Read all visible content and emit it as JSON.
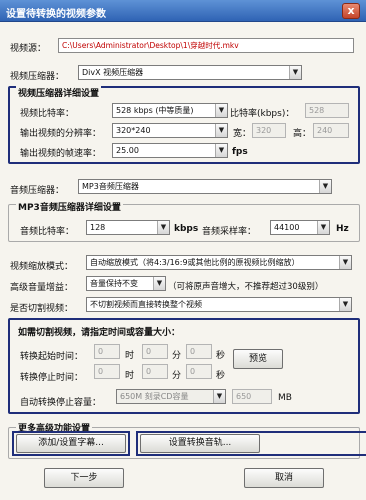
{
  "window": {
    "title": "设置待转换的视频参数",
    "close_label": "x"
  },
  "source": {
    "label": "视频源：",
    "path": "C:\\Users\\Administrator\\Desktop\\1\\穿越时代.mkv"
  },
  "video_codec": {
    "label": "视频压缩器：",
    "value": "DivX 视频压缩器"
  },
  "video_details": {
    "title": "视频压缩器详细设置",
    "bitrate_label": "视频比特率：",
    "bitrate_value": "528  kbps (中等质量)",
    "bitrate_kbps_label": "比特率(kbps)：",
    "bitrate_kbps_value": "528",
    "resolution_label": "输出视频的分辨率：",
    "resolution_value": "320*240",
    "width_label": "宽：",
    "width_value": "320",
    "height_label": "高：",
    "height_value": "240",
    "fps_label": "输出视频的帧速率：",
    "fps_value": "25.00",
    "fps_unit": "fps"
  },
  "audio_codec": {
    "label": "音频压缩器：",
    "value": "MP3音频压缩器"
  },
  "audio_details": {
    "title": "MP3音频压缩器详细设置",
    "bitrate_label": "音频比特率：",
    "bitrate_value": "128",
    "bitrate_unit": "kbps",
    "samplerate_label": "音频采样率：",
    "samplerate_value": "44100",
    "samplerate_unit": "Hz"
  },
  "scaling": {
    "label": "视频缩放模式：",
    "value": "自动缩放模式（将4:3/16:9或其他比例的原视频比例缩放）"
  },
  "volume": {
    "label": "高级音量增益：",
    "value": "音量保持不变",
    "note": "（可将原声音增大，不推荐超过30级别）"
  },
  "cut": {
    "label": "是否切割视频：",
    "value": "不切割视频而直接转换整个视频"
  },
  "cut_settings": {
    "title": "如需切割视频，请指定时间或容量大小：",
    "start_label": "转换起始时间：",
    "end_label": "转换停止时间：",
    "start": [
      "0",
      "0",
      "0"
    ],
    "end": [
      "0",
      "0",
      "0"
    ],
    "hour_unit": "时",
    "minute_unit": "分",
    "second_unit": "秒",
    "preview_label": "预览",
    "capacity_label": "自动转换停止容量：",
    "capacity_value": "650M 刻录CD容量",
    "capacity_number": "650",
    "capacity_unit": "MB"
  },
  "advanced": {
    "title": "更多高级功能设置",
    "subtitle_button": "添加/设置字幕...",
    "audio_track_button": "设置转换音轨..."
  },
  "footer": {
    "next_label": "下一步",
    "cancel_label": "取消"
  }
}
